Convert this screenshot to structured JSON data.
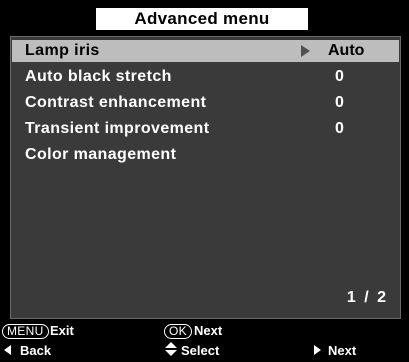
{
  "menu": {
    "title": "Advanced menu",
    "page_indicator": "1 / 2",
    "items": [
      {
        "label": "Lamp iris",
        "value": "Auto",
        "selected": true
      },
      {
        "label": "Auto black stretch",
        "value": "0",
        "selected": false
      },
      {
        "label": "Contrast enhancement",
        "value": "0",
        "selected": false
      },
      {
        "label": "Transient improvement",
        "value": "0",
        "selected": false
      },
      {
        "label": "Color management",
        "value": "",
        "selected": false
      }
    ]
  },
  "footer": {
    "menu_key": "MENU",
    "exit_label": "Exit",
    "ok_key": "OK",
    "next_top_label": "Next",
    "back_label": "Back",
    "select_label": "Select",
    "next_label": "Next"
  },
  "icons": {
    "selected_arrow": "triangle-right-icon",
    "back": "triangle-left-icon",
    "select": "up-down-triangle-icon",
    "next": "triangle-right-icon"
  },
  "colors": {
    "background": "#000000",
    "panel": "#3a3a3a",
    "selected_row": "#bdbdbd",
    "title_box": "#ffffff",
    "text": "#ffffff"
  }
}
